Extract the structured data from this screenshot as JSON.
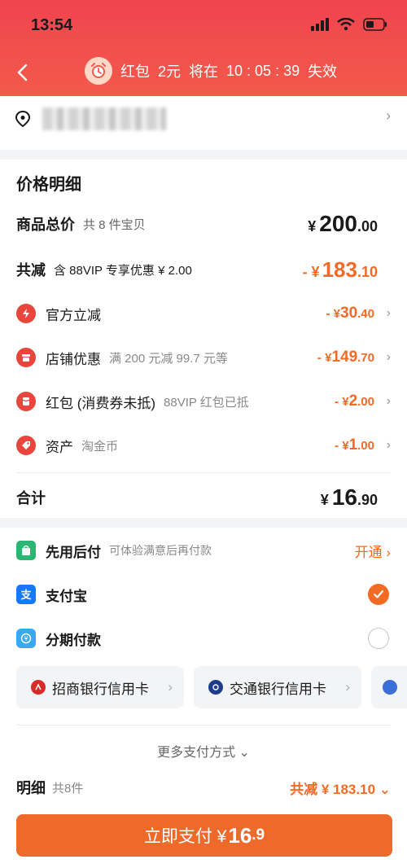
{
  "status": {
    "time": "13:54"
  },
  "countdown": {
    "label": "红包",
    "amount": "2元",
    "text": "将在",
    "time": "10 : 05 : 39",
    "suffix": "失效"
  },
  "price_detail": {
    "title": "价格明细",
    "total": {
      "label": "商品总价",
      "sub": "共 8 件宝贝",
      "currency": "¥",
      "int": "200",
      "dec": ".00"
    },
    "reduce": {
      "label": "共减",
      "sub": "含 88VIP 专享优惠 ¥ 2.00",
      "prefix": "- ¥",
      "int": "183",
      "dec": ".10"
    },
    "discounts": [
      {
        "name": "官方立减",
        "note": "",
        "prefix": "- ¥",
        "int": "30",
        "dec": ".40",
        "icon": "lightning-icon"
      },
      {
        "name": "店铺优惠",
        "note": "满 200 元减 99.7 元等",
        "prefix": "- ¥",
        "int": "149",
        "dec": ".70",
        "icon": "shop-icon"
      },
      {
        "name": "红包 (消费券未抵)",
        "note": "88VIP 红包已抵",
        "prefix": "- ¥",
        "int": "2",
        "dec": ".00",
        "icon": "red-packet-icon"
      },
      {
        "name": "资产",
        "note": "淘金币",
        "prefix": "- ¥",
        "int": "1",
        "dec": ".00",
        "icon": "tag-icon"
      }
    ],
    "sum": {
      "label": "合计",
      "currency": "¥",
      "int": "16",
      "dec": ".90"
    }
  },
  "payment": {
    "pay_later": {
      "name": "先用后付",
      "note": "可体验满意后再付款",
      "action": "开通 ›"
    },
    "alipay": {
      "name": "支付宝"
    },
    "installment": {
      "name": "分期付款"
    },
    "banks": [
      {
        "name": "招商银行信用卡"
      },
      {
        "name": "交通银行信用卡"
      }
    ],
    "more": "更多支付方式 ⌄"
  },
  "detail": {
    "label": "明细",
    "count": "共8件",
    "total_disc": "共减 ¥ 183.10 ⌄"
  },
  "pay_button": {
    "label": "立即支付 ¥",
    "int": "16",
    "dec": ".9"
  },
  "colors": {
    "accent": "#f26a23",
    "header": "#f0444f"
  }
}
